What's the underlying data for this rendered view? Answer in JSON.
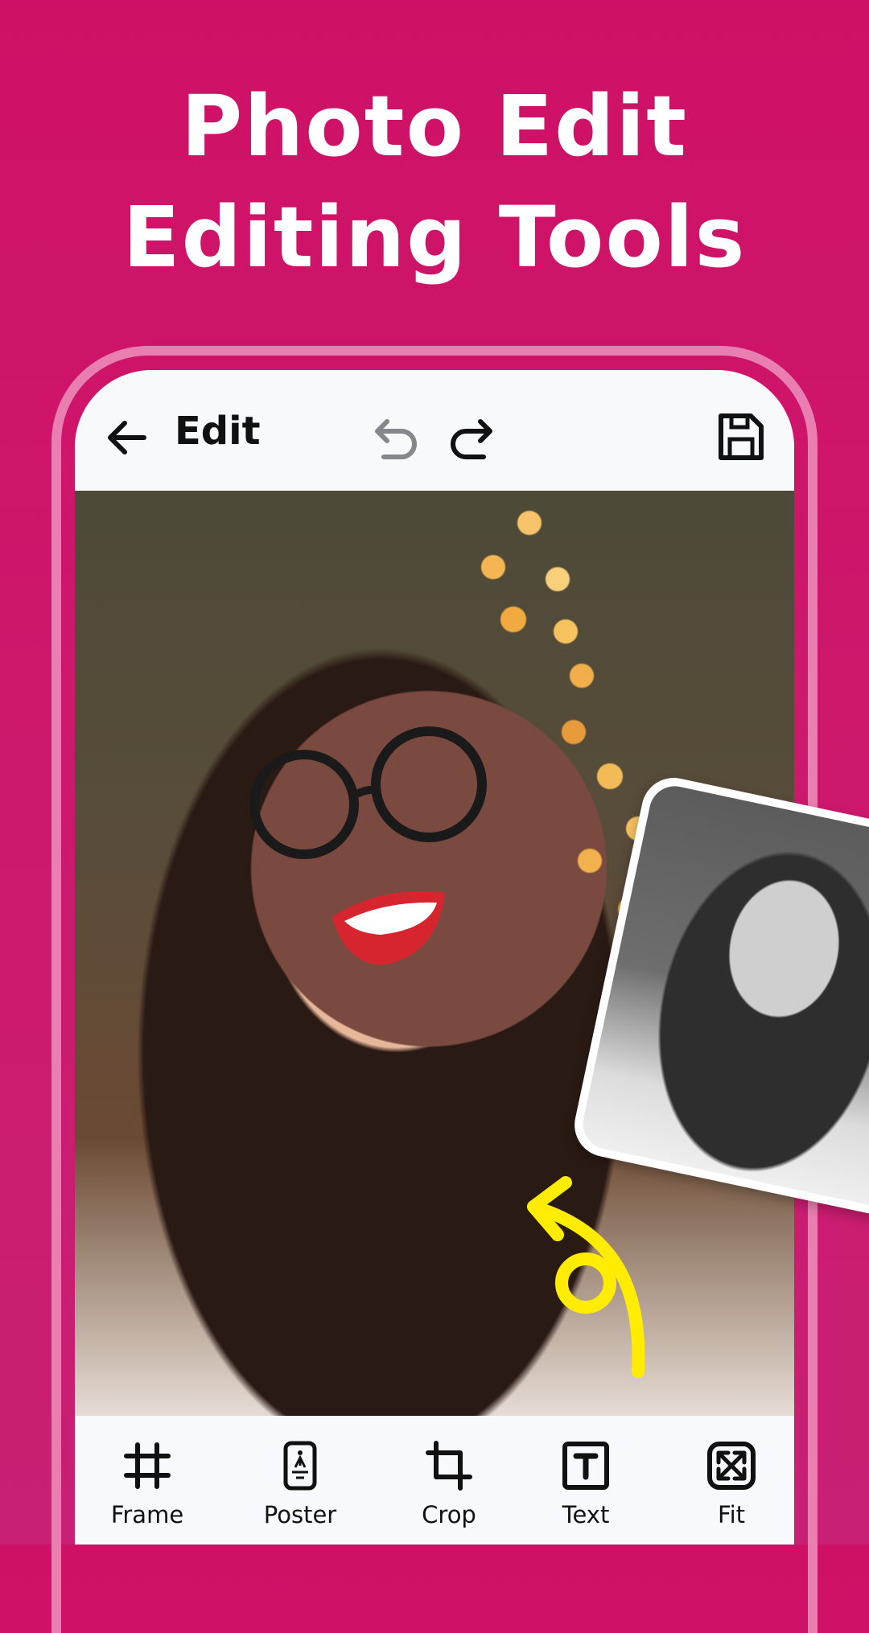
{
  "headline": {
    "line1": "Photo Edit",
    "line2": "Editing Tools"
  },
  "colors": {
    "background": "#cf1166",
    "phone_outline": "#e87fb0",
    "arrow": "#ffec00"
  },
  "topbar": {
    "back_icon": "arrow-left-icon",
    "title": "Edit",
    "undo_icon": "undo-icon",
    "redo_icon": "redo-icon",
    "save_icon": "floppy-disk-icon"
  },
  "canvas": {
    "main_photo": "woman with glasses and fairy lights (color)",
    "preview_photo": "same photo in black and white",
    "annotation": "yellow curly arrow"
  },
  "toolbar": {
    "tools": [
      {
        "label": "Frame",
        "icon": "hash-grid-icon"
      },
      {
        "label": "Poster",
        "icon": "poster-icon"
      },
      {
        "label": "Crop",
        "icon": "crop-icon"
      },
      {
        "label": "Text",
        "icon": "text-box-icon"
      },
      {
        "label": "Fit",
        "icon": "fit-expand-icon"
      }
    ]
  }
}
